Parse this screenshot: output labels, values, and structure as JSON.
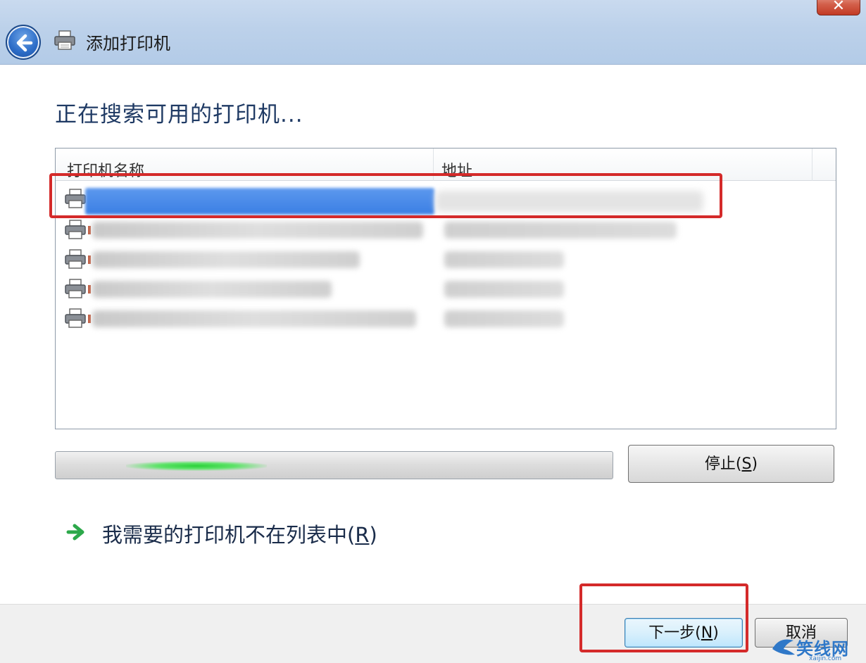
{
  "window": {
    "title": "添加打印机",
    "close_label": "✕"
  },
  "main": {
    "heading": "正在搜索可用的打印机...",
    "list": {
      "columns": [
        "打印机名称",
        "地址"
      ],
      "rows": [
        {
          "selected": true
        },
        {
          "selected": false
        },
        {
          "selected": false
        },
        {
          "selected": false
        },
        {
          "selected": false
        }
      ]
    },
    "progress_label": "",
    "stop_button": {
      "text": "停止(",
      "key": "S",
      "end": ")"
    },
    "not_listed_link": {
      "text": "我需要的打印机不在列表中(",
      "key": "R",
      "end": ")"
    }
  },
  "footer": {
    "next_button": {
      "text": "下一步(",
      "key": "N",
      "end": ")"
    },
    "cancel_button": {
      "text": "取消"
    }
  },
  "watermark": {
    "text": "笑线网",
    "sub": "xaijin.com"
  },
  "colors": {
    "selection": "#3b7fe4",
    "annotation_red": "#d42a2a",
    "progress_green": "#2ad13a",
    "title_bar": "#bcd1ea"
  }
}
